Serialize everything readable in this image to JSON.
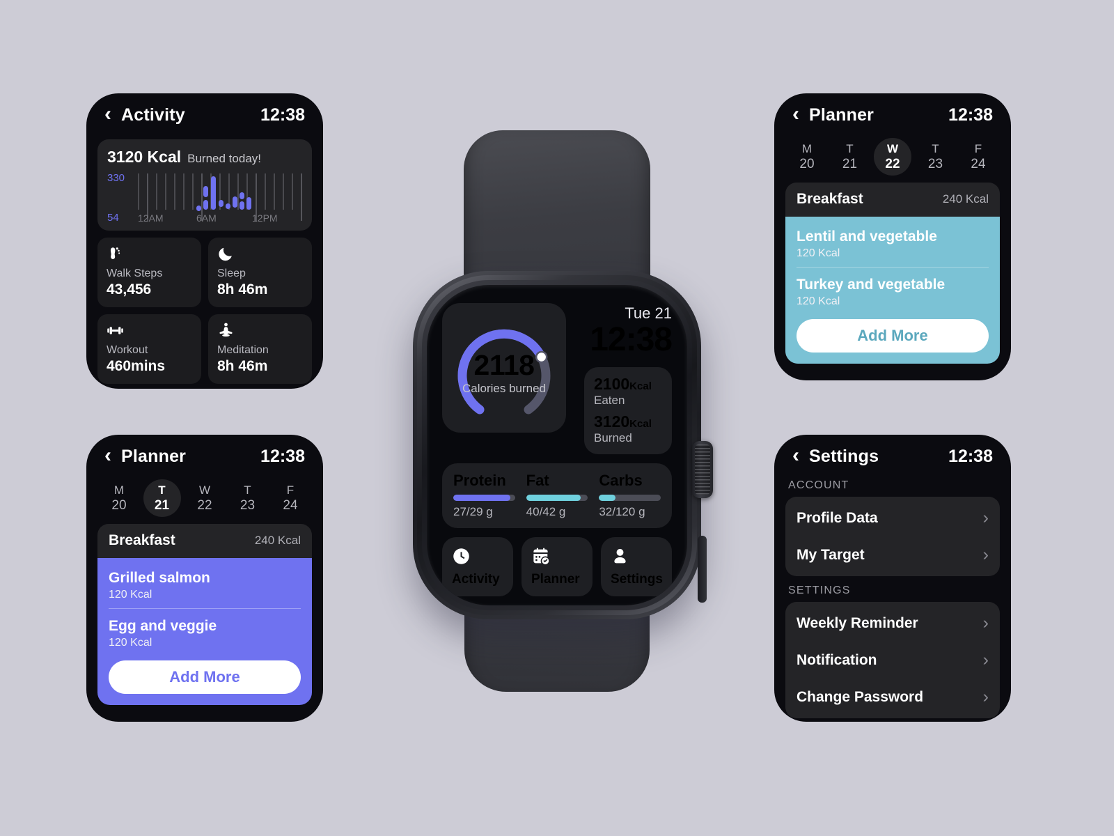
{
  "canvas": {
    "background": "#cdccd6"
  },
  "colors": {
    "purple": "#6f72f0",
    "teal": "#7bc2d5",
    "teal_fill": "#6fd0dd",
    "card": "#242427",
    "screen_bg": "#0b0b10"
  },
  "activity_screen": {
    "back_icon": "chevron-left-icon",
    "title": "Activity",
    "time": "12:38",
    "calorie_card": {
      "value": "3120 Kcal",
      "subtitle": "Burned today!",
      "axis_max": "330",
      "axis_min": "54",
      "time_labels": [
        "12AM",
        "6AM",
        "12PM"
      ]
    },
    "stats": [
      {
        "icon": "footprint-icon",
        "label": "Walk Steps",
        "value": "43,456"
      },
      {
        "icon": "moon-icon",
        "label": "Sleep",
        "value": "8h 46m"
      },
      {
        "icon": "dumbbell-icon",
        "label": "Workout",
        "value": "460mins"
      },
      {
        "icon": "meditation-icon",
        "label": "Meditation",
        "value": "8h 46m"
      }
    ]
  },
  "planner_left": {
    "back_icon": "chevron-left-icon",
    "title": "Planner",
    "time": "12:38",
    "days": [
      {
        "day": "M",
        "num": "20",
        "selected": false
      },
      {
        "day": "T",
        "num": "21",
        "selected": true
      },
      {
        "day": "W",
        "num": "22",
        "selected": false
      },
      {
        "day": "T",
        "num": "23",
        "selected": false
      },
      {
        "day": "F",
        "num": "24",
        "selected": false
      }
    ],
    "meal": {
      "name": "Breakfast",
      "kcal": "240 Kcal",
      "items": [
        {
          "title": "Grilled salmon",
          "kcal": "120 Kcal"
        },
        {
          "title": "Egg and veggie",
          "kcal": "120 Kcal"
        }
      ],
      "add_label": "Add More"
    }
  },
  "planner_right": {
    "back_icon": "chevron-left-icon",
    "title": "Planner",
    "time": "12:38",
    "days": [
      {
        "day": "M",
        "num": "20",
        "selected": false
      },
      {
        "day": "T",
        "num": "21",
        "selected": false
      },
      {
        "day": "W",
        "num": "22",
        "selected": true
      },
      {
        "day": "T",
        "num": "23",
        "selected": false
      },
      {
        "day": "F",
        "num": "24",
        "selected": false
      }
    ],
    "meal": {
      "name": "Breakfast",
      "kcal": "240 Kcal",
      "items": [
        {
          "title": "Lentil and vegetable",
          "kcal": "120 Kcal"
        },
        {
          "title": "Turkey and vegetable",
          "kcal": "120 Kcal"
        }
      ],
      "add_label": "Add More"
    }
  },
  "settings_screen": {
    "back_icon": "chevron-left-icon",
    "title": "Settings",
    "time": "12:38",
    "sections": [
      {
        "heading": "ACCOUNT",
        "rows": [
          {
            "label": "Profile Data",
            "chevron": "chevron-right-icon"
          },
          {
            "label": "My Target",
            "chevron": "chevron-right-icon"
          }
        ]
      },
      {
        "heading": "SETTINGS",
        "rows": [
          {
            "label": "Weekly Reminder",
            "chevron": "chevron-right-icon"
          },
          {
            "label": "Notification",
            "chevron": "chevron-right-icon"
          },
          {
            "label": "Change Password",
            "chevron": "chevron-right-icon"
          }
        ]
      }
    ]
  },
  "watch": {
    "date": "Tue 21",
    "time": "12:38",
    "gauge": {
      "value": "2118",
      "label": "Calories burned",
      "percent": 72,
      "track_color": "#55566a",
      "fill_color": "#6f72f0"
    },
    "kcal": {
      "eaten_value": "2100",
      "eaten_unit": "Kcal",
      "eaten_label": "Eaten",
      "burned_value": "3120",
      "burned_unit": "Kcal",
      "burned_label": "Burned"
    },
    "macros": [
      {
        "name": "Protein",
        "value": "27/29 g",
        "percent": 93,
        "color": "#6f72f0"
      },
      {
        "name": "Fat",
        "value": "40/42 g",
        "percent": 88,
        "color": "#6fd0dd"
      },
      {
        "name": "Carbs",
        "value": "32/120 g",
        "percent": 27,
        "color": "#6fd0dd"
      }
    ],
    "nav": [
      {
        "icon": "clock-icon",
        "label": "Activity"
      },
      {
        "icon": "calendar-check-icon",
        "label": "Planner"
      },
      {
        "icon": "person-icon",
        "label": "Settings"
      }
    ]
  },
  "chart_data": {
    "type": "bar",
    "title": "3120 Kcal Burned today!",
    "xlabel": "",
    "ylabel": "Kcal",
    "ylim": [
      54,
      330
    ],
    "grid": true,
    "legend": "none",
    "x_tick_labels": [
      "12AM",
      "6AM",
      "12PM"
    ],
    "y_tick_labels": [
      "330",
      "54"
    ],
    "bar_color": "#6f72f0",
    "categories": [
      "b1",
      "b2",
      "b3",
      "b4",
      "b5",
      "b6",
      "b7",
      "b8",
      "b9",
      "b10",
      "b11"
    ],
    "values": [
      70,
      180,
      130,
      300,
      90,
      60,
      110,
      80,
      175,
      120,
      140
    ]
  }
}
